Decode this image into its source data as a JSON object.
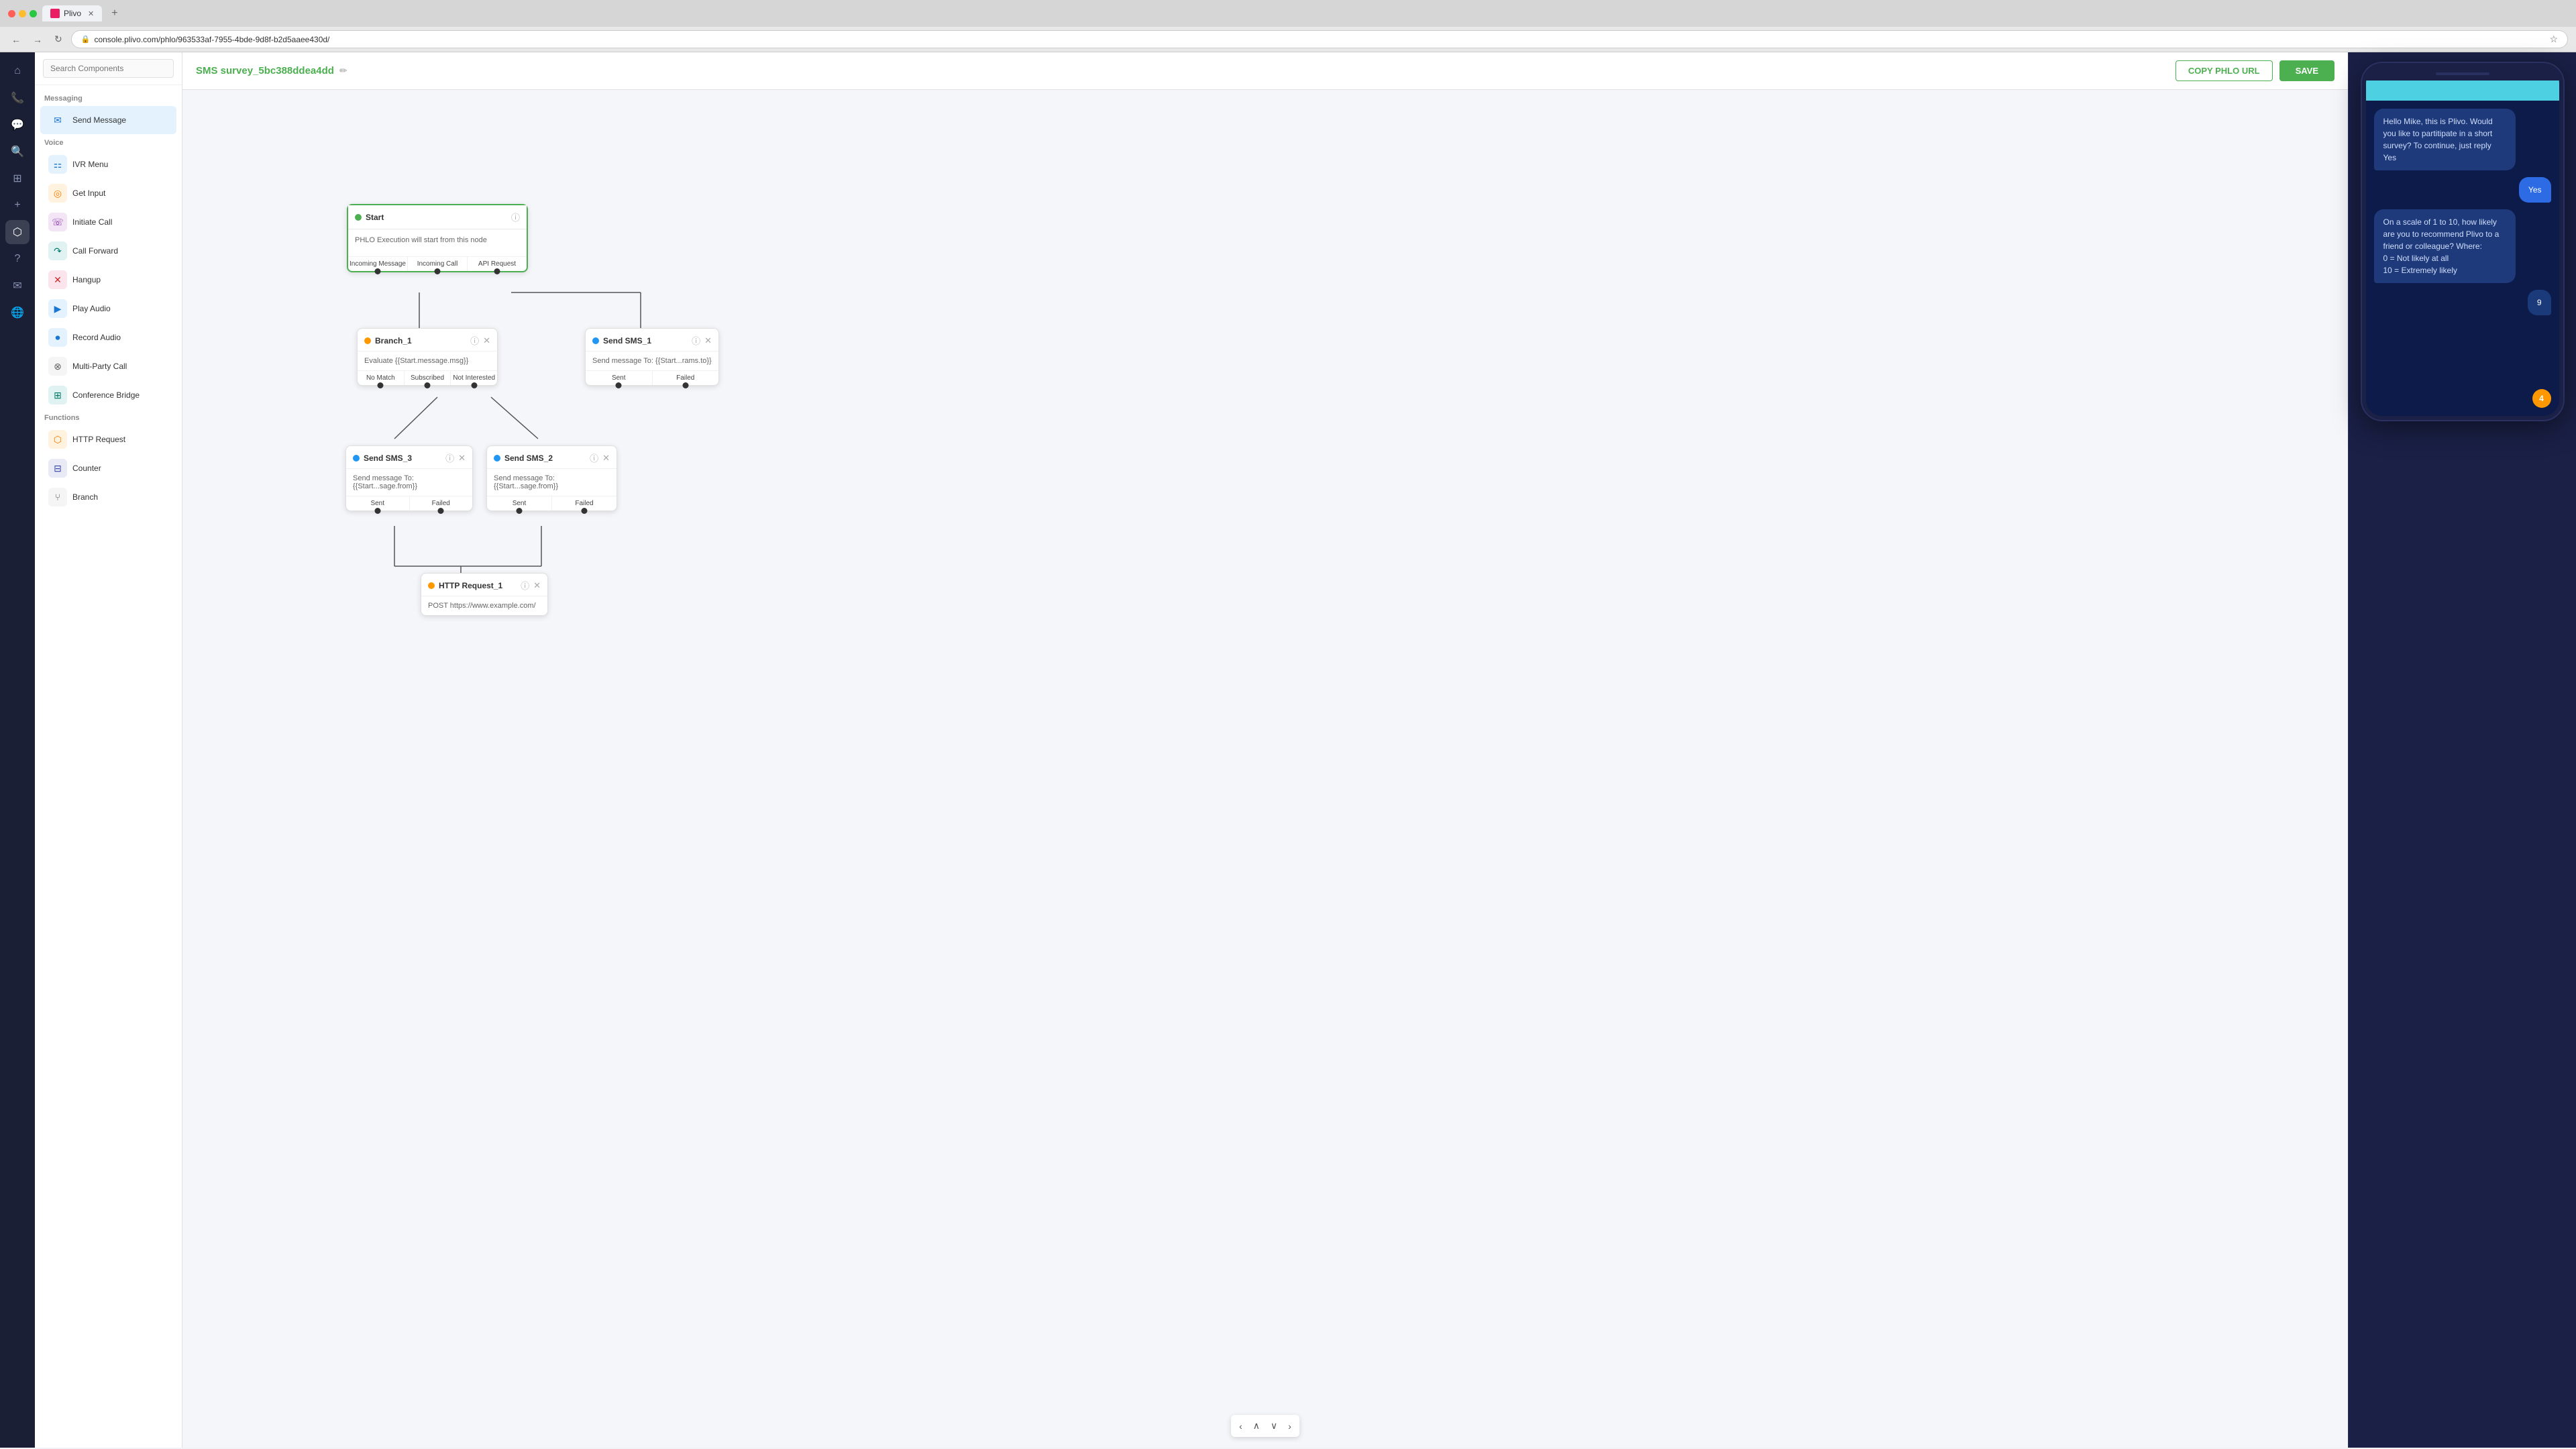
{
  "browser": {
    "tab_title": "Plivo",
    "url": "console.plivo.com/phlo/963533af-7955-4bde-9d8f-b2d5aaee430d/",
    "nav_back": "←",
    "nav_forward": "→",
    "nav_refresh": "↻"
  },
  "header": {
    "phlo_name": "SMS survey_5bc388ddea4dd",
    "copy_btn": "COPY PHLO URL",
    "save_btn": "SAVE"
  },
  "sidebar": {
    "icons": [
      "phone-icon",
      "message-icon",
      "search-icon",
      "grid-icon",
      "plus-icon",
      "flow-icon",
      "question-icon",
      "mail-icon",
      "globe-icon"
    ]
  },
  "components": {
    "search_placeholder": "Search Components",
    "sections": [
      {
        "title": "Messaging",
        "items": [
          {
            "label": "Send Message",
            "icon_type": "blue",
            "icon": "✉"
          }
        ]
      },
      {
        "title": "Voice",
        "items": [
          {
            "label": "IVR Menu",
            "icon_type": "blue",
            "icon": "⚏"
          },
          {
            "label": "Get Input",
            "icon_type": "orange",
            "icon": "◎"
          },
          {
            "label": "Initiate Call",
            "icon_type": "purple",
            "icon": "☏"
          },
          {
            "label": "Call Forward",
            "icon_type": "teal",
            "icon": "↷"
          },
          {
            "label": "Hangup",
            "icon_type": "red",
            "icon": "✕"
          },
          {
            "label": "Play Audio",
            "icon_type": "blue",
            "icon": "▶"
          },
          {
            "label": "Record Audio",
            "icon_type": "blue",
            "icon": "⏺"
          },
          {
            "label": "Multi-Party Call",
            "icon_type": "gray",
            "icon": "⊗"
          },
          {
            "label": "Conference Bridge",
            "icon_type": "teal",
            "icon": "⊞"
          }
        ]
      },
      {
        "title": "Functions",
        "items": [
          {
            "label": "HTTP Request",
            "icon_type": "orange",
            "icon": "⬡"
          },
          {
            "label": "Counter",
            "icon_type": "indigo",
            "icon": "⊟"
          },
          {
            "label": "Branch",
            "icon_type": "gray",
            "icon": "⑂"
          }
        ]
      }
    ]
  },
  "flow": {
    "start_node": {
      "title": "Start",
      "body": "PHLO Execution will start from this node",
      "ports": [
        "Incoming Message",
        "Incoming Call",
        "API Request"
      ]
    },
    "branch_node": {
      "id": "Branch_1",
      "body": "Evaluate {{Start.message.msg}}",
      "ports": [
        "No Match",
        "Subscribed",
        "Not Interested"
      ]
    },
    "send_sms_1": {
      "id": "Send SMS_1",
      "body": "Send message To: {{Start...rams.to}}",
      "ports": [
        "Sent",
        "Failed"
      ]
    },
    "send_sms_3": {
      "id": "Send SMS_3",
      "body": "Send message To: {{Start...sage.from}}",
      "ports": [
        "Sent",
        "Failed"
      ]
    },
    "send_sms_2": {
      "id": "Send SMS_2",
      "body": "Send message To: {{Start...sage.from}}",
      "ports": [
        "Sent",
        "Failed"
      ]
    },
    "http_request_1": {
      "id": "HTTP Request_1",
      "body": "POST https://www.example.com/"
    }
  },
  "phone": {
    "messages": [
      {
        "type": "received",
        "text": "Hello Mike, this is Plivo. Would you like to partitipate in a short survey? To continue, just reply Yes"
      },
      {
        "type": "sent",
        "text": "Yes"
      },
      {
        "type": "received",
        "text": "On a scale of 1 to 10, how likely are you to recommend Plivo to a friend or colleague? Where:\n0 = Not likely at all\n10 = Extremely likely"
      },
      {
        "type": "sent-dark",
        "text": "9"
      }
    ],
    "badge": "4"
  }
}
